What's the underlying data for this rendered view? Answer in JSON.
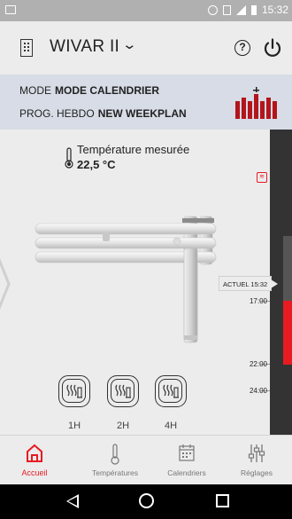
{
  "status_bar": {
    "time": "15:32"
  },
  "header": {
    "device_name": "WIVAR II"
  },
  "mode_panel": {
    "mode_label": "MODE",
    "mode_value": "MODE CALENDRIER",
    "prog_label": "PROG. HEBDO",
    "prog_value": "NEW WEEKPLAN"
  },
  "temperature": {
    "label": "Température mesurée",
    "value": "22,5 °C"
  },
  "boost": {
    "buttons": [
      {
        "label": "1H"
      },
      {
        "label": "2H"
      },
      {
        "label": "4H"
      }
    ]
  },
  "timeline": {
    "current_marker": "ACTUEL 15:32",
    "times": [
      "17:00",
      "22:00",
      "24:00"
    ],
    "colors": {
      "active": "#e81b23",
      "track": "#333333"
    }
  },
  "nav": {
    "items": [
      {
        "label": "Accueil",
        "active": true
      },
      {
        "label": "Températures",
        "active": false
      },
      {
        "label": "Calendriers",
        "active": false
      },
      {
        "label": "Réglages",
        "active": false
      }
    ]
  },
  "colors": {
    "accent": "#e81b23",
    "panel": "#d7dce6",
    "background": "#ececec"
  }
}
